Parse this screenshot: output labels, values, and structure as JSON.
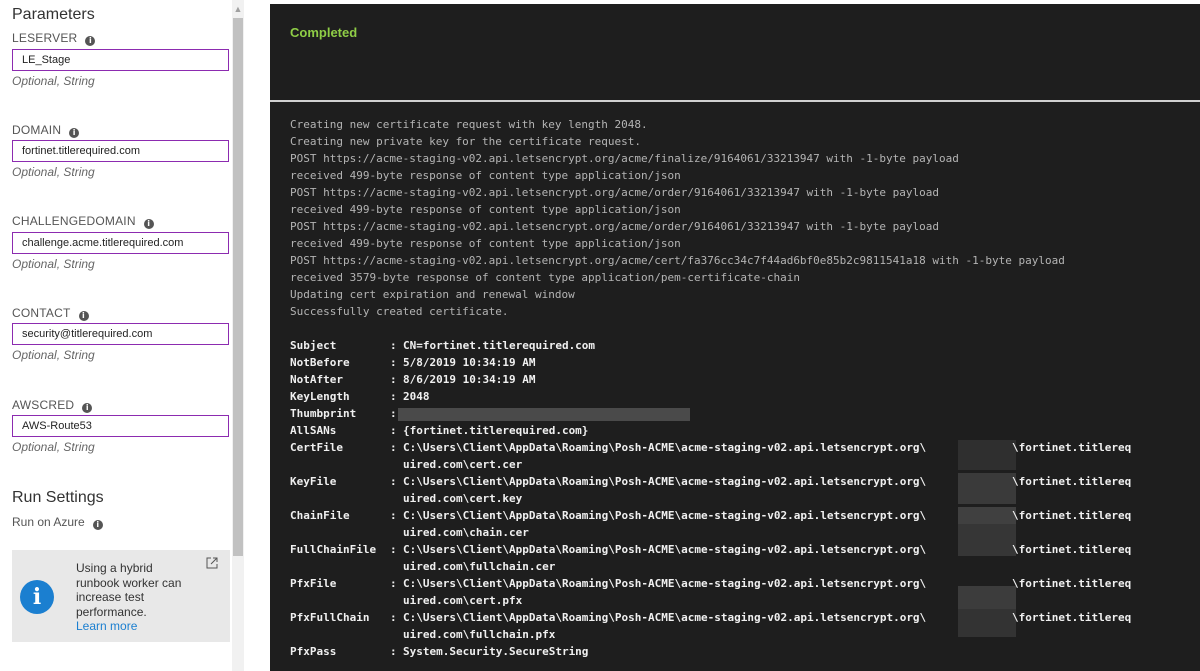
{
  "parameters": {
    "title": "Parameters",
    "fields": [
      {
        "label": "LESERVER",
        "value": "LE_Stage",
        "hint": "Optional, String"
      },
      {
        "label": "DOMAIN",
        "value": "fortinet.titlerequired.com",
        "hint": "Optional, String"
      },
      {
        "label": "CHALLENGEDOMAIN",
        "value": "challenge.acme.titlerequired.com",
        "hint": "Optional, String"
      },
      {
        "label": "CONTACT",
        "value": "security@titlerequired.com",
        "hint": "Optional, String"
      },
      {
        "label": "AWSCRED",
        "value": "AWS-Route53",
        "hint": "Optional, String"
      }
    ]
  },
  "run_settings": {
    "title": "Run Settings",
    "run_on": "Run on Azure"
  },
  "hybrid_info": {
    "text": "Using a hybrid runbook worker can increase test performance.",
    "link": "Learn more",
    "icon": "info-icon",
    "external_icon": "external-link-icon"
  },
  "output": {
    "status": "Completed",
    "log_lines": [
      "Creating new certificate request with key length 2048.",
      "Creating new private key for the certificate request.",
      "POST https://acme-staging-v02.api.letsencrypt.org/acme/finalize/9164061/33213947 with -1-byte payload",
      "received 499-byte response of content type application/json",
      "POST https://acme-staging-v02.api.letsencrypt.org/acme/order/9164061/33213947 with -1-byte payload",
      "received 499-byte response of content type application/json",
      "POST https://acme-staging-v02.api.letsencrypt.org/acme/order/9164061/33213947 with -1-byte payload",
      "received 499-byte response of content type application/json",
      "POST https://acme-staging-v02.api.letsencrypt.org/acme/cert/fa376cc34c7f44ad6bf0e85b2c9811541a18 with -1-byte payload",
      "received 3579-byte response of content type application/pem-certificate-chain",
      "Updating cert expiration and renewal window",
      "Successfully created certificate."
    ],
    "properties": [
      {
        "key": "Subject",
        "value": "CN=fortinet.titlerequired.com"
      },
      {
        "key": "NotBefore",
        "value": "5/8/2019 10:34:19 AM"
      },
      {
        "key": "NotAfter",
        "value": "8/6/2019 10:34:19 AM"
      },
      {
        "key": "KeyLength",
        "value": "2048"
      },
      {
        "key": "Thumbprint",
        "value": ""
      },
      {
        "key": "AllSANs",
        "value": "{fortinet.titlerequired.com}"
      },
      {
        "key": "CertFile",
        "value": "C:\\Users\\Client\\AppData\\Roaming\\Posh-ACME\\acme-staging-v02.api.letsencrypt.org\\",
        "value_end": "\\fortinet.titlereq",
        "value2": "uired.com\\cert.cer"
      },
      {
        "key": "KeyFile",
        "value": "C:\\Users\\Client\\AppData\\Roaming\\Posh-ACME\\acme-staging-v02.api.letsencrypt.org\\",
        "value_end": "\\fortinet.titlereq",
        "value2": "uired.com\\cert.key"
      },
      {
        "key": "ChainFile",
        "value": "C:\\Users\\Client\\AppData\\Roaming\\Posh-ACME\\acme-staging-v02.api.letsencrypt.org\\",
        "value_end": "\\fortinet.titlereq",
        "value2": "uired.com\\chain.cer"
      },
      {
        "key": "FullChainFile",
        "value": "C:\\Users\\Client\\AppData\\Roaming\\Posh-ACME\\acme-staging-v02.api.letsencrypt.org\\",
        "value_end": "\\fortinet.titlereq",
        "value2": "uired.com\\fullchain.cer"
      },
      {
        "key": "PfxFile",
        "value": "C:\\Users\\Client\\AppData\\Roaming\\Posh-ACME\\acme-staging-v02.api.letsencrypt.org\\",
        "value_end": "\\fortinet.titlereq",
        "value2": "uired.com\\cert.pfx"
      },
      {
        "key": "PfxFullChain",
        "value": "C:\\Users\\Client\\AppData\\Roaming\\Posh-ACME\\acme-staging-v02.api.letsencrypt.org\\",
        "value_end": "\\fortinet.titlereq",
        "value2": "uired.com\\fullchain.pfx"
      },
      {
        "key": "PfxPass",
        "value": "System.Security.SecureString"
      }
    ]
  },
  "colors": {
    "input_border": "#8c2bb0",
    "status_green": "#8fcd46",
    "console_bg": "#1e1e1e",
    "link_blue": "#1b7fd0"
  }
}
